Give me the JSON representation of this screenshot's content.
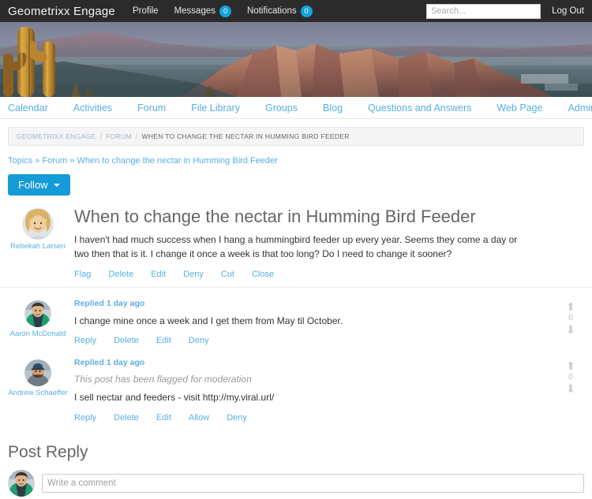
{
  "topbar": {
    "brand": "Geometrixx Engage",
    "nav": [
      {
        "label": "Profile",
        "badge": null
      },
      {
        "label": "Messages",
        "badge": "0"
      },
      {
        "label": "Notifications",
        "badge": "0"
      }
    ],
    "search_placeholder": "Search...",
    "search_value": "",
    "logout_label": "Log Out",
    "background_color": "#2b2b2b",
    "badge_color": "#13a3dc"
  },
  "mainnav": {
    "items": [
      {
        "label": "Calendar"
      },
      {
        "label": "Activities"
      },
      {
        "label": "Forum"
      },
      {
        "label": "File Library"
      },
      {
        "label": "Groups"
      },
      {
        "label": "Blog"
      },
      {
        "label": "Questions and Answers"
      },
      {
        "label": "Web Page"
      },
      {
        "label": "Administration"
      }
    ],
    "link_color": "#5aafe0"
  },
  "breadcrumb_box": {
    "items": [
      {
        "label": "GEOMETRIXX ENGAGE",
        "current": false
      },
      {
        "label": "FORUM",
        "current": false
      },
      {
        "label": "WHEN TO CHANGE THE NECTAR IN HUMMING BIRD FEEDER",
        "current": true
      }
    ],
    "separator": "/"
  },
  "topic_path": {
    "items": [
      {
        "label": "Topics"
      },
      {
        "label": "Forum"
      },
      {
        "label": "When to change the nectar in Humming Bird Feeder"
      }
    ],
    "separator": "»"
  },
  "follow_button": {
    "label": "Follow",
    "color": "#159bd7"
  },
  "thread": {
    "original_post": {
      "author": "Rebekah Larsen",
      "title": "When to change the nectar in Humming Bird Feeder",
      "body": "I haven't had much success when I hang a hummingbird feeder up every year. Seems they come a day or two then that is it. I change it once a week is that too long? Do I need to change it sooner?",
      "actions": [
        "Flag",
        "Delete",
        "Edit",
        "Deny",
        "Cut",
        "Close"
      ]
    },
    "replies": [
      {
        "author": "Aaron McDonald",
        "time": "Replied 1 day ago",
        "flag_note": "",
        "body": "I change mine once a week and I get them from May til October.",
        "actions": [
          "Reply",
          "Delete",
          "Edit",
          "Deny"
        ],
        "vote_count": "0"
      },
      {
        "author": "Andrew Schaeffer",
        "time": "Replied 1 day ago",
        "flag_note": "This post has been flagged for moderation",
        "body": "I sell nectar and feeders - visit http://my.viral.url/",
        "actions": [
          "Reply",
          "Delete",
          "Edit",
          "Allow",
          "Deny"
        ],
        "vote_count": "0"
      }
    ]
  },
  "post_reply": {
    "heading": "Post Reply",
    "input_placeholder": "Write a comment",
    "input_value": ""
  }
}
